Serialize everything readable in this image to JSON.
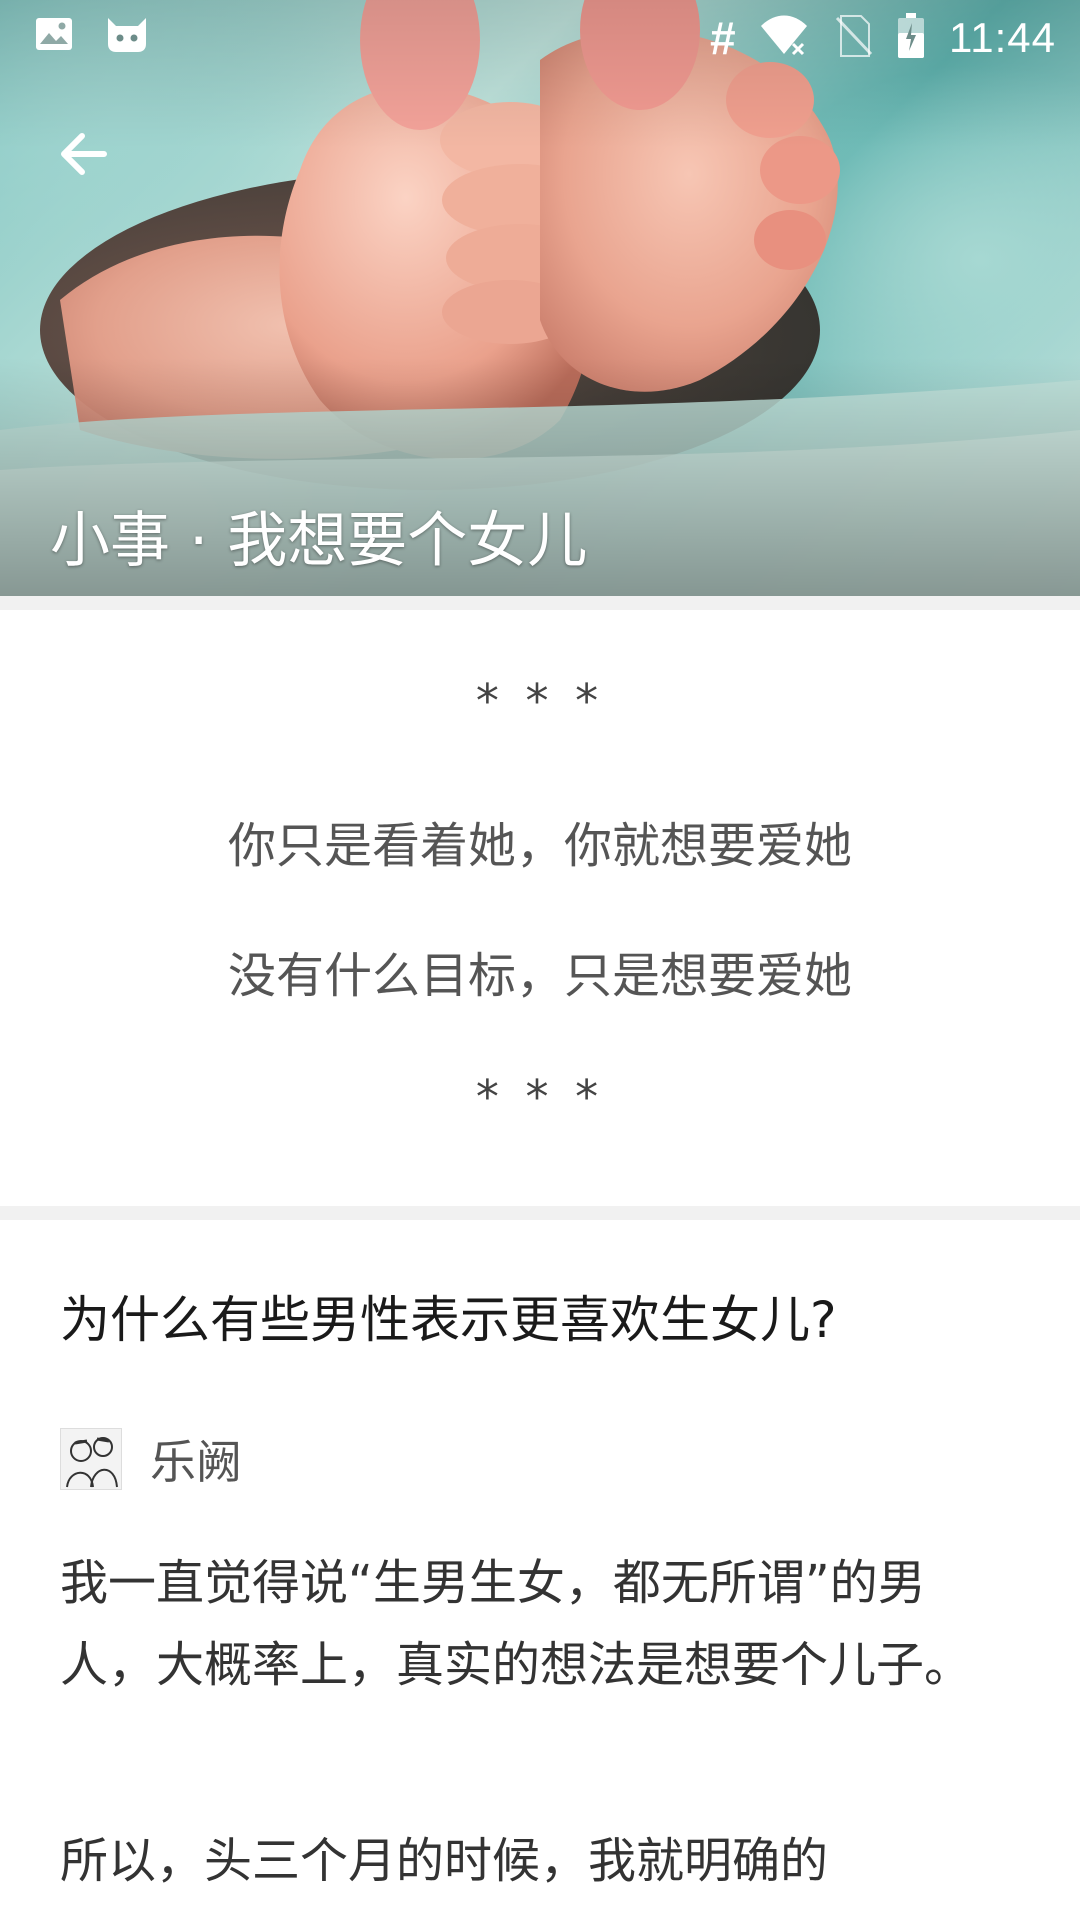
{
  "status_bar": {
    "time": "11:44",
    "hash_symbol": "#",
    "icons": [
      "image-icon",
      "cat-icon",
      "wifi-icon",
      "no-sim-icon",
      "battery-icon"
    ]
  },
  "header": {
    "title": "小事 · 我想要个女儿",
    "back_icon": "arrow-left-icon"
  },
  "quote": {
    "stars_top": "* * *",
    "line1": "你只是看着她，你就想要爱她",
    "line2": "没有什么目标，只是想要爱她",
    "stars_bottom": "* * *"
  },
  "article": {
    "question": "为什么有些男性表示更喜欢生女儿?",
    "author": "乐阙",
    "paragraphs": [
      "我一直觉得说“生男生女，都无所谓”的男人，大概率上，真实的想法是想要个儿子。",
      "所以，头三个月的时候，我就明确的"
    ]
  },
  "colors": {
    "background": "#ffffff",
    "divider": "#f1f1f1",
    "text_primary": "#1a1a1a",
    "text_secondary": "#555555"
  }
}
